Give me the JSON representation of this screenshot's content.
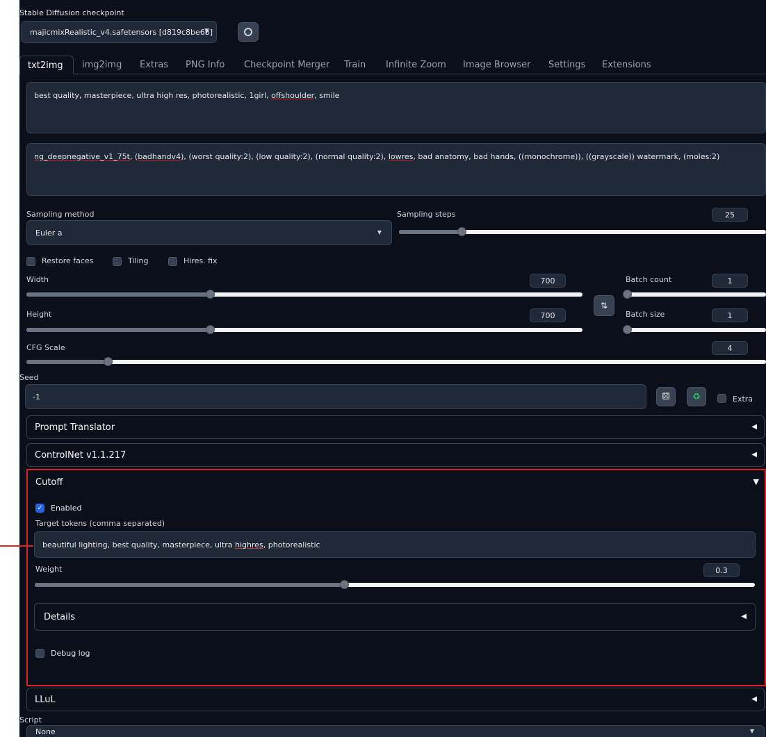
{
  "checkpoint": {
    "label": "Stable Diffusion checkpoint",
    "value": "majicmixRealistic_v4.safetensors [d819c8be6b]"
  },
  "tabs": [
    "txt2img",
    "img2img",
    "Extras",
    "PNG Info",
    "Checkpoint Merger",
    "Train",
    "Infinite Zoom",
    "Image Browser",
    "Settings",
    "Extensions"
  ],
  "active_tab": "txt2img",
  "prompt": {
    "a": "best quality, masterpiece, ultra high res, photorealistic, 1girl, ",
    "b": "offshoulder",
    "c": ", smile"
  },
  "negative_prompt": {
    "a": "ng_deepnegative_v1_75t",
    "b": ", (",
    "c": "badhandv4",
    "d": "), (worst quality:2), (low quality:2), (normal quality:2), ",
    "e": "lowres",
    "f": ", bad anatomy, bad hands, ((monochrome)), ((grayscale)) watermark, (moles:2)"
  },
  "sampling": {
    "method_label": "Sampling method",
    "method_value": "Euler a",
    "steps_label": "Sampling steps",
    "steps_value": "25",
    "steps_fraction": 0.17
  },
  "options": {
    "restore_faces": "Restore faces",
    "tiling": "Tiling",
    "hires_fix": "Hires. fix"
  },
  "width": {
    "label": "Width",
    "value": "700",
    "fraction": 0.33
  },
  "height": {
    "label": "Height",
    "value": "700",
    "fraction": 0.33
  },
  "batch_count": {
    "label": "Batch count",
    "value": "1",
    "fraction": 0.0
  },
  "batch_size": {
    "label": "Batch size",
    "value": "1",
    "fraction": 0.0
  },
  "cfg": {
    "label": "CFG Scale",
    "value": "4",
    "fraction": 0.11
  },
  "seed": {
    "label": "Seed",
    "value": "-1",
    "extra_label": "Extra"
  },
  "accordions": {
    "prompt_translator": "Prompt Translator",
    "controlnet": "ControlNet v1.1.217",
    "cutoff": "Cutoff",
    "lllul": "LLuL"
  },
  "cutoff": {
    "enabled_label": "Enabled",
    "target_label": "Target tokens (comma separated)",
    "target_a": "beautiful lighting, best quality, masterpiece, ultra ",
    "target_b": "highres",
    "target_c": ", photorealistic",
    "weight_label": "Weight",
    "weight_value": "0.3",
    "weight_fraction": 0.43,
    "details_label": "Details",
    "debug_label": "Debug log"
  },
  "script": {
    "label": "Script",
    "value": "None"
  },
  "colors": {
    "background": "#0b0f19",
    "highlight": "#dc2626",
    "checkbox_on": "#2563eb"
  }
}
